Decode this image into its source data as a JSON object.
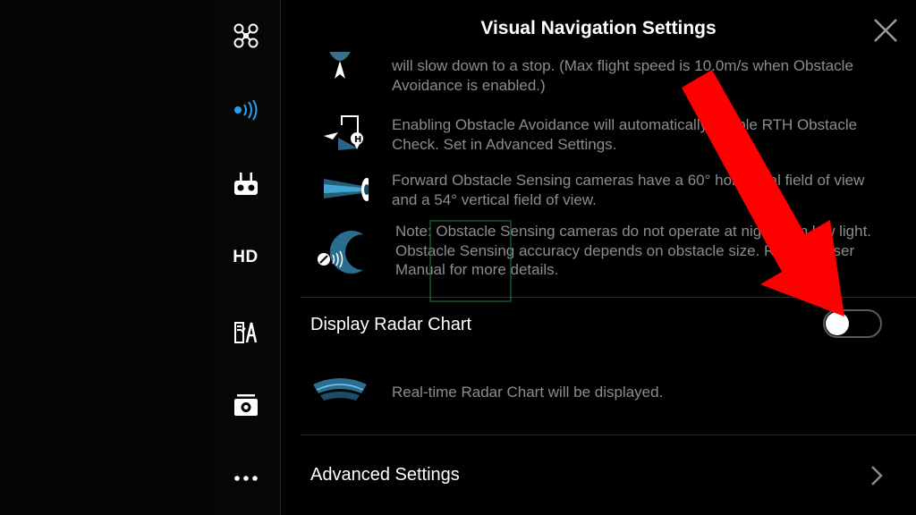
{
  "sidebar": {
    "items": [
      {
        "icon": "aircraft-icon"
      },
      {
        "icon": "vision-sensing-icon",
        "active": true
      },
      {
        "icon": "remote-controller-icon"
      },
      {
        "icon": "hd-transmission-icon",
        "label": "HD"
      },
      {
        "icon": "battery-icon"
      },
      {
        "icon": "camera-icon"
      },
      {
        "icon": "more-icon"
      }
    ]
  },
  "panel": {
    "title": "Visual Navigation Settings",
    "info_items": [
      {
        "icon": "slow-down-icon",
        "text": "will slow down to a stop. (Max flight speed is 10.0m/s when Obstacle Avoidance is enabled.)"
      },
      {
        "icon": "rth-obstacle-icon",
        "text": "Enabling Obstacle Avoidance will automatically enable RTH Obstacle Check. Set in Advanced Settings."
      },
      {
        "icon": "forward-sensor-icon",
        "text": "Forward Obstacle Sensing cameras have a 60° horizontal field of view and a 54° vertical field of view."
      },
      {
        "icon": "night-sensor-icon",
        "text": "Note: Obstacle Sensing cameras do not operate at night or in low light. Obstacle Sensing accuracy depends on obstacle size. Refer to User Manual for more details."
      }
    ],
    "radar_setting": {
      "label": "Display Radar Chart",
      "enabled": false
    },
    "radar_info": "Real-time Radar Chart will be displayed.",
    "advanced": {
      "label": "Advanced Settings"
    }
  },
  "colors": {
    "accent": "#2f9cf0",
    "annotation_arrow": "#ff0000"
  }
}
